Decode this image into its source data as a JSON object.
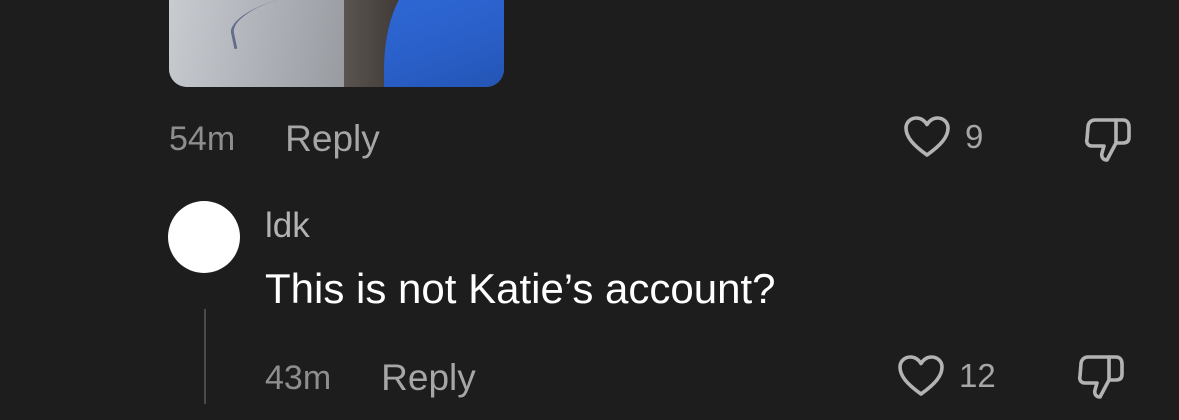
{
  "parent_comment": {
    "media_alt_icon": "photo-thumbnail",
    "time": "54m",
    "reply_label": "Reply",
    "like_count": "9"
  },
  "reply_comment": {
    "username": "ldk",
    "text": "This is not Katie’s account?",
    "time": "43m",
    "reply_label": "Reply",
    "like_count": "12"
  },
  "colors": {
    "background": "#1d1d1d",
    "text_primary": "#ffffff",
    "text_secondary": "#a6a6a6",
    "text_muted": "#8e8e8e",
    "avatar": "#ffffff"
  },
  "icons": {
    "like": "heart-outline-icon",
    "dislike": "thumbs-down-outline-icon"
  }
}
